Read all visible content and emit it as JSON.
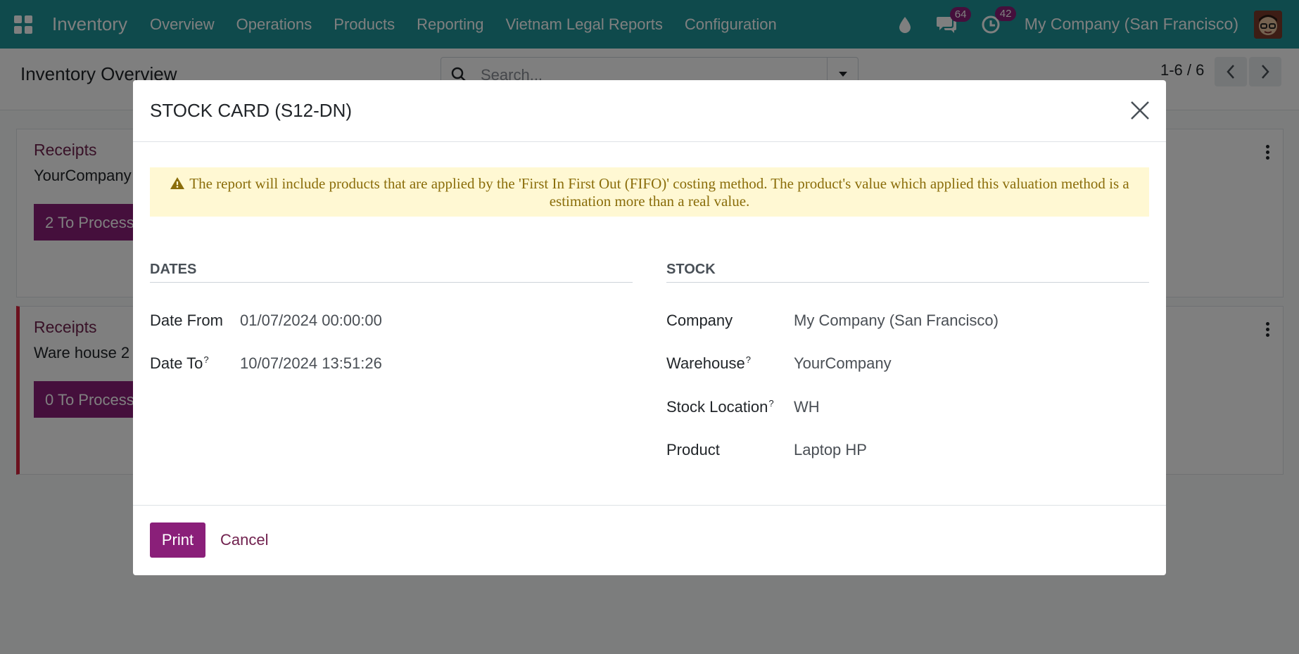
{
  "navbar": {
    "app_name": "Inventory",
    "menu": [
      "Overview",
      "Operations",
      "Products",
      "Reporting",
      "Vietnam Legal Reports",
      "Configuration"
    ],
    "messages_count": "64",
    "activities_count": "42",
    "company": "My Company (San Francisco)",
    "accent_color": "#1e9598"
  },
  "control_panel": {
    "title": "Inventory Overview",
    "search_placeholder": "Search...",
    "pager": "1-6 / 6"
  },
  "cards": [
    {
      "title": "Receipts",
      "subtitle": "YourCompany",
      "button": "2 To Process"
    },
    {
      "title": "Receipts",
      "subtitle": "Ware house 2",
      "button": "0 To Process"
    }
  ],
  "modal": {
    "title": "STOCK CARD (S12-DN)",
    "alert": "The report will include products that are applied by the 'First In First Out (FIFO)' costing method. The product's value which applied this valuation method is a estimation more than a real value.",
    "dates_section": "DATES",
    "stock_section": "STOCK",
    "date_from_label": "Date From",
    "date_from_value": "01/07/2024 00:00:00",
    "date_to_label": "Date To",
    "date_to_value": "10/07/2024 13:51:26",
    "company_label": "Company",
    "company_value": "My Company (San Francisco)",
    "warehouse_label": "Warehouse",
    "warehouse_value": "YourCompany",
    "location_label": "Stock Location",
    "location_value": "WH",
    "product_label": "Product",
    "product_value": "Laptop HP",
    "help_mark": "?",
    "print_label": "Print",
    "cancel_label": "Cancel",
    "primary_color": "#8a1f79"
  }
}
